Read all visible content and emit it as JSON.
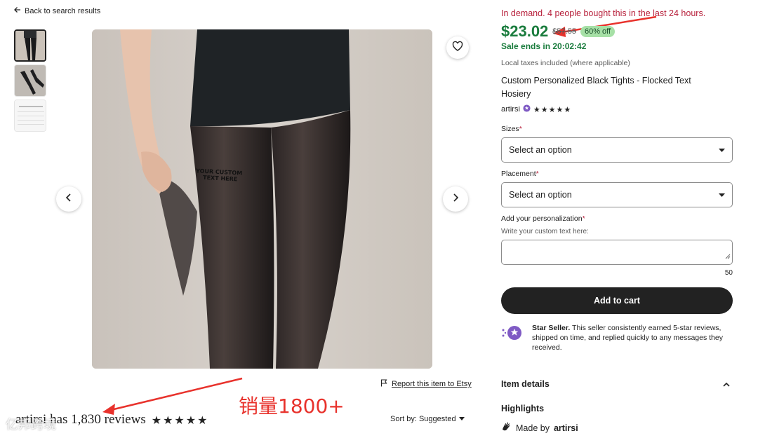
{
  "back_link": "Back to search results",
  "report": "Report this item to Etsy",
  "reviews": {
    "text": "artirsi has 1,830 reviews",
    "stars": "★★★★★"
  },
  "sort": {
    "label": "Sort by: Suggested"
  },
  "annotation": "销量1800+",
  "watermark": "亿邦跨境",
  "photo_text": [
    "YOUR CUSTOM",
    "TEXT HERE"
  ],
  "product": {
    "demand": "In demand. 4 people bought this in the last 24 hours.",
    "price": "$23.02",
    "original_price": "$57.55",
    "discount": "60% off",
    "sale_ends": "Sale ends in 20:02:42",
    "tax_note": "Local taxes included (where applicable)",
    "title": "Custom Personalized Black Tights - Flocked Text Hosiery",
    "seller": "artirsi",
    "seller_stars": "★★★★★"
  },
  "form": {
    "sizes_label": "Sizes",
    "placement_label": "Placement",
    "select_placeholder": "Select an option",
    "personalization_label": "Add your personalization",
    "personalization_hint": "Write your custom text here:",
    "char_count": "50",
    "add_to_cart": "Add to cart"
  },
  "star_seller": {
    "title": "Star Seller.",
    "text": "This seller consistently earned 5-star reviews, shipped on time, and replied quickly to any messages they received."
  },
  "details": {
    "heading": "Item details",
    "highlights": "Highlights",
    "made_by_prefix": "Made by",
    "made_by_name": "artirsi"
  },
  "colors": {
    "price_green": "#1a7c3d",
    "demand_red": "#b7203b",
    "annotation_red": "#e8322c",
    "cart_bg": "#222222"
  }
}
